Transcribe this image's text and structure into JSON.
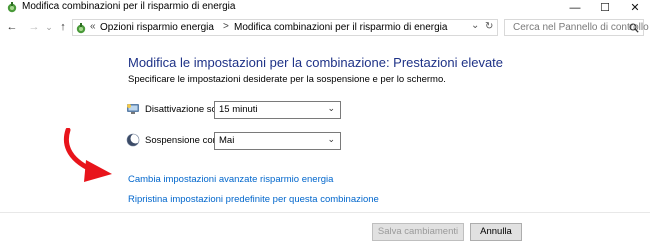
{
  "window": {
    "title": "Modifica combinazioni per il risparmio di energia",
    "minimize_glyph": "—",
    "maximize_glyph": "☐",
    "close_glyph": "✕"
  },
  "nav": {
    "back_glyph": "←",
    "forward_glyph": "→",
    "recent_glyph": "⌄",
    "up_glyph": "↑",
    "address": {
      "overflow": "«",
      "segments": [
        "Opzioni risparmio energia",
        "Modifica combinazioni per il risparmio di energia"
      ],
      "separator": ">"
    },
    "dropdown_glyph": "⌄",
    "refresh_glyph": "↻",
    "search_placeholder": "Cerca nel Pannello di controllo",
    "search_icon": "search-icon"
  },
  "main": {
    "heading": "Modifica le impostazioni per la combinazione: Prestazioni elevate",
    "subtitle": "Specificare le impostazioni desiderate per la sospensione e per lo schermo.",
    "settings": [
      {
        "label": "Disattivazione schermo:",
        "value": "15 minuti",
        "icon": "monitor-icon"
      },
      {
        "label": "Sospensione computer:",
        "value": "Mai",
        "icon": "moon-icon"
      }
    ],
    "link_advanced": "Cambia impostazioni avanzate risparmio energia",
    "link_restore": "Ripristina impostazioni predefinite per questa combinazione"
  },
  "footer": {
    "save": "Salva cambiamenti",
    "cancel": "Annulla"
  },
  "colors": {
    "heading": "#1e3287",
    "link": "#0066cc",
    "annotation_arrow": "#e8141b"
  }
}
